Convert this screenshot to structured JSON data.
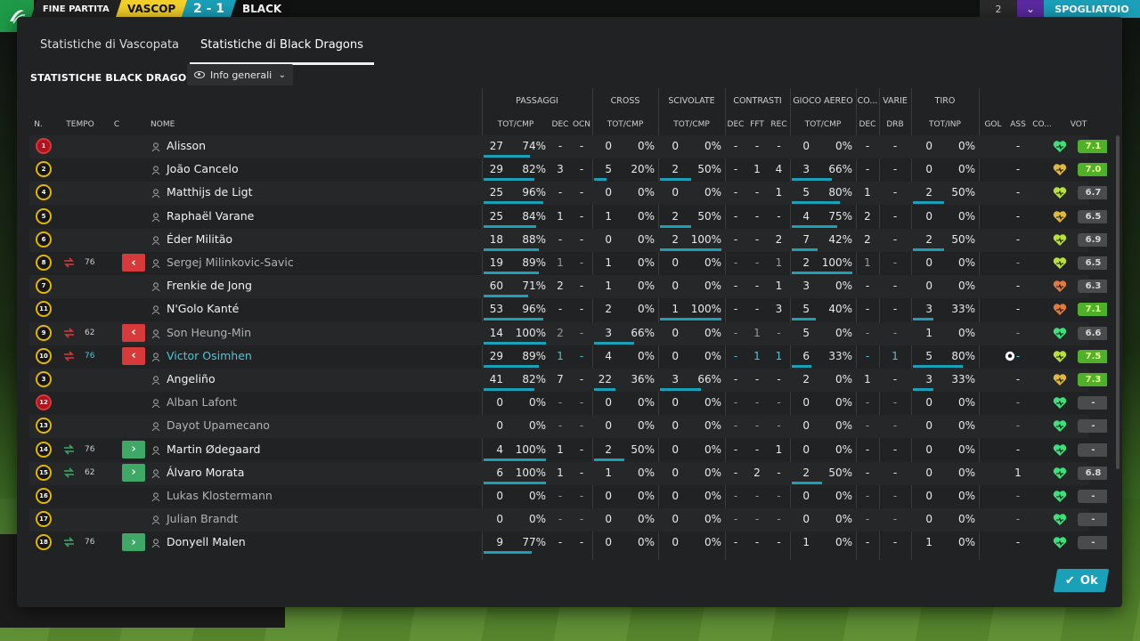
{
  "topbar": {
    "end_label": "FINE PARTITA",
    "home": "VASCOP",
    "score": "2 - 1",
    "away": "BLACK",
    "right_count": "2",
    "right_button": "SPOGLIATOIO"
  },
  "tabs": [
    {
      "label": "Statistiche di Vascopata",
      "active": false
    },
    {
      "label": "Statistiche di Black Dragons",
      "active": true
    }
  ],
  "section_title": "STATISTICHE BLACK DRAGONS",
  "dropdown": {
    "label": "Info generali",
    "icon": "eye-icon"
  },
  "groups": {
    "passaggi": "PASSAGGI",
    "cross": "CROSS",
    "scivolate": "SCIVOLATE",
    "contrasti": "CONTRASTI",
    "gioco_aereo": "GIOCO AEREO",
    "co": "CO...",
    "varie": "VARIE",
    "tiro": "TIRO"
  },
  "columns": {
    "n": "N.",
    "tempo": "TEMPO",
    "c": "C",
    "nome": "NOME",
    "pass_tot": "TOT/CMP",
    "dec": "DEC",
    "ocn": "OCN",
    "cross_tot": "TOT/CMP",
    "sciv_tot": "TOT/CMP",
    "con_dec": "DEC",
    "fft": "FFT",
    "rec": "REC",
    "aereo_tot": "TOT/CMP",
    "co_dec": "DEC",
    "drb": "DRB",
    "tiro_tot": "TOT/INP",
    "gol": "GOL",
    "ass": "ASS",
    "co2": "CO...",
    "vot": "VOT"
  },
  "players": [
    {
      "num": "1",
      "gk": true,
      "min": "",
      "sub": "",
      "name": "Alisson",
      "style": "",
      "pass": [
        "27",
        "74%"
      ],
      "pbar": 0.74,
      "pdec": "-",
      "pocn": "-",
      "cross": [
        "0",
        "0%"
      ],
      "cbar": 0,
      "sciv": [
        "0",
        "0%"
      ],
      "sbar": 0,
      "cdec": "-",
      "fft": "-",
      "rec": "-",
      "aer": [
        "0",
        "0%"
      ],
      "abar": 0,
      "codec": "-",
      "drb": "-",
      "tiro": [
        "0",
        "0%"
      ],
      "tbar": 0,
      "gol": "",
      "ass": "-",
      "heart": "#3ee07a",
      "vot": "7.1",
      "vcls": "green"
    },
    {
      "num": "2",
      "gk": false,
      "min": "",
      "sub": "",
      "name": "João Cancelo",
      "style": "",
      "pass": [
        "29",
        "82%"
      ],
      "pbar": 0.82,
      "pdec": "3",
      "pocn": "-",
      "cross": [
        "5",
        "20%"
      ],
      "cbar": 0.2,
      "sciv": [
        "2",
        "50%"
      ],
      "sbar": 0.5,
      "cdec": "-",
      "fft": "1",
      "rec": "4",
      "aer": [
        "3",
        "66%"
      ],
      "abar": 0.66,
      "codec": "-",
      "drb": "-",
      "tiro": [
        "0",
        "0%"
      ],
      "tbar": 0,
      "gol": "",
      "ass": "-",
      "heart": "#e0b840",
      "vot": "7.0",
      "vcls": "green"
    },
    {
      "num": "4",
      "gk": false,
      "min": "",
      "sub": "",
      "name": "Matthijs de Ligt",
      "style": "",
      "pass": [
        "25",
        "96%"
      ],
      "pbar": 0.96,
      "pdec": "-",
      "pocn": "-",
      "cross": [
        "0",
        "0%"
      ],
      "cbar": 0,
      "sciv": [
        "0",
        "0%"
      ],
      "sbar": 0,
      "cdec": "-",
      "fft": "-",
      "rec": "1",
      "aer": [
        "5",
        "80%"
      ],
      "abar": 0.8,
      "codec": "1",
      "drb": "-",
      "tiro": [
        "2",
        "50%"
      ],
      "tbar": 0.5,
      "gol": "",
      "ass": "-",
      "heart": "#b9e03a",
      "vot": "6.7",
      "vcls": "gray"
    },
    {
      "num": "5",
      "gk": false,
      "min": "",
      "sub": "",
      "name": "Raphaël Varane",
      "style": "",
      "pass": [
        "25",
        "84%"
      ],
      "pbar": 0.84,
      "pdec": "1",
      "pocn": "-",
      "cross": [
        "1",
        "0%"
      ],
      "cbar": 0,
      "sciv": [
        "2",
        "50%"
      ],
      "sbar": 0.5,
      "cdec": "-",
      "fft": "-",
      "rec": "-",
      "aer": [
        "4",
        "75%"
      ],
      "abar": 0.75,
      "codec": "2",
      "drb": "-",
      "tiro": [
        "0",
        "0%"
      ],
      "tbar": 0,
      "gol": "",
      "ass": "-",
      "heart": "#e0b840",
      "vot": "6.5",
      "vcls": "gray"
    },
    {
      "num": "6",
      "gk": false,
      "min": "",
      "sub": "",
      "name": "Éder Militão",
      "style": "",
      "pass": [
        "18",
        "88%"
      ],
      "pbar": 0.88,
      "pdec": "-",
      "pocn": "-",
      "cross": [
        "0",
        "0%"
      ],
      "cbar": 0,
      "sciv": [
        "2",
        "100%"
      ],
      "sbar": 1,
      "cdec": "-",
      "fft": "-",
      "rec": "2",
      "aer": [
        "7",
        "42%"
      ],
      "abar": 0.42,
      "codec": "2",
      "drb": "-",
      "tiro": [
        "2",
        "50%"
      ],
      "tbar": 0.5,
      "gol": "",
      "ass": "-",
      "heart": "#b9e03a",
      "vot": "6.9",
      "vcls": "gray"
    },
    {
      "num": "8",
      "gk": false,
      "min": "76",
      "sub": "out",
      "name": "Sergej Milinkovic-Savic",
      "style": "dim",
      "pass": [
        "19",
        "89%"
      ],
      "pbar": 0.89,
      "pdec": "1",
      "pocn": "-",
      "cross": [
        "1",
        "0%"
      ],
      "cbar": 0,
      "sciv": [
        "0",
        "0%"
      ],
      "sbar": 0,
      "cdec": "-",
      "fft": "-",
      "rec": "1",
      "aer": [
        "2",
        "100%"
      ],
      "abar": 1,
      "codec": "1",
      "drb": "-",
      "tiro": [
        "0",
        "0%"
      ],
      "tbar": 0,
      "gol": "",
      "ass": "-",
      "heart": "#b9e03a",
      "vot": "6.5",
      "vcls": "gray"
    },
    {
      "num": "7",
      "gk": false,
      "min": "",
      "sub": "",
      "name": "Frenkie de Jong",
      "style": "",
      "pass": [
        "60",
        "71%"
      ],
      "pbar": 0.71,
      "pdec": "2",
      "pocn": "-",
      "cross": [
        "1",
        "0%"
      ],
      "cbar": 0,
      "sciv": [
        "0",
        "0%"
      ],
      "sbar": 0,
      "cdec": "-",
      "fft": "-",
      "rec": "1",
      "aer": [
        "3",
        "0%"
      ],
      "abar": 0,
      "codec": "-",
      "drb": "-",
      "tiro": [
        "0",
        "0%"
      ],
      "tbar": 0,
      "gol": "",
      "ass": "-",
      "heart": "#e07a40",
      "vot": "6.3",
      "vcls": "gray"
    },
    {
      "num": "11",
      "gk": false,
      "min": "",
      "sub": "",
      "name": "N'Golo Kanté",
      "style": "",
      "pass": [
        "53",
        "96%"
      ],
      "pbar": 0.96,
      "pdec": "-",
      "pocn": "-",
      "cross": [
        "2",
        "0%"
      ],
      "cbar": 0,
      "sciv": [
        "1",
        "100%"
      ],
      "sbar": 1,
      "cdec": "-",
      "fft": "-",
      "rec": "3",
      "aer": [
        "5",
        "40%"
      ],
      "abar": 0.4,
      "codec": "-",
      "drb": "-",
      "tiro": [
        "3",
        "33%"
      ],
      "tbar": 0.33,
      "gol": "",
      "ass": "-",
      "heart": "#e07a40",
      "vot": "7.1",
      "vcls": "green"
    },
    {
      "num": "9",
      "gk": false,
      "min": "62",
      "sub": "out",
      "name": "Son Heung-Min",
      "style": "dim",
      "pass": [
        "14",
        "100%"
      ],
      "pbar": 1,
      "pdec": "2",
      "pocn": "-",
      "cross": [
        "3",
        "66%"
      ],
      "cbar": 0.66,
      "sciv": [
        "0",
        "0%"
      ],
      "sbar": 0,
      "cdec": "-",
      "fft": "1",
      "rec": "-",
      "aer": [
        "5",
        "0%"
      ],
      "abar": 0,
      "codec": "-",
      "drb": "-",
      "tiro": [
        "1",
        "0%"
      ],
      "tbar": 0,
      "gol": "",
      "ass": "-",
      "heart": "#3ee07a",
      "vot": "6.6",
      "vcls": "gray"
    },
    {
      "num": "10",
      "gk": false,
      "min": "76",
      "sub": "out",
      "name": "Victor Osimhen",
      "style": "hl",
      "pass": [
        "29",
        "89%"
      ],
      "pbar": 0.89,
      "pdec": "1",
      "pocn": "-",
      "cross": [
        "4",
        "0%"
      ],
      "cbar": 0,
      "sciv": [
        "0",
        "0%"
      ],
      "sbar": 0,
      "cdec": "-",
      "fft": "1",
      "rec": "1",
      "aer": [
        "6",
        "33%"
      ],
      "abar": 0.33,
      "codec": "-",
      "drb": "1",
      "tiro": [
        "5",
        "80%"
      ],
      "tbar": 0.8,
      "gol": "ball",
      "ass": "-",
      "heart": "#b9e03a",
      "vot": "7.5",
      "vcls": "green"
    },
    {
      "num": "3",
      "gk": false,
      "min": "",
      "sub": "",
      "name": "Angeliño",
      "style": "",
      "pass": [
        "41",
        "82%"
      ],
      "pbar": 0.82,
      "pdec": "7",
      "pocn": "-",
      "cross": [
        "22",
        "36%"
      ],
      "cbar": 0.36,
      "sciv": [
        "3",
        "66%"
      ],
      "sbar": 0.66,
      "cdec": "-",
      "fft": "-",
      "rec": "-",
      "aer": [
        "2",
        "0%"
      ],
      "abar": 0,
      "codec": "1",
      "drb": "-",
      "tiro": [
        "3",
        "33%"
      ],
      "tbar": 0.33,
      "gol": "",
      "ass": "-",
      "heart": "#e0b840",
      "vot": "7.3",
      "vcls": "green"
    },
    {
      "num": "12",
      "gk": true,
      "min": "",
      "sub": "",
      "name": "Alban Lafont",
      "style": "dim",
      "pass": [
        "0",
        "0%"
      ],
      "pbar": 0,
      "pdec": "-",
      "pocn": "-",
      "cross": [
        "0",
        "0%"
      ],
      "cbar": 0,
      "sciv": [
        "0",
        "0%"
      ],
      "sbar": 0,
      "cdec": "-",
      "fft": "-",
      "rec": "-",
      "aer": [
        "0",
        "0%"
      ],
      "abar": 0,
      "codec": "-",
      "drb": "-",
      "tiro": [
        "0",
        "0%"
      ],
      "tbar": 0,
      "gol": "",
      "ass": "-",
      "heart": "#3ee07a",
      "vot": "-",
      "vcls": "gray"
    },
    {
      "num": "13",
      "gk": false,
      "min": "",
      "sub": "",
      "name": "Dayot Upamecano",
      "style": "dim",
      "pass": [
        "0",
        "0%"
      ],
      "pbar": 0,
      "pdec": "-",
      "pocn": "-",
      "cross": [
        "0",
        "0%"
      ],
      "cbar": 0,
      "sciv": [
        "0",
        "0%"
      ],
      "sbar": 0,
      "cdec": "-",
      "fft": "-",
      "rec": "-",
      "aer": [
        "0",
        "0%"
      ],
      "abar": 0,
      "codec": "-",
      "drb": "-",
      "tiro": [
        "0",
        "0%"
      ],
      "tbar": 0,
      "gol": "",
      "ass": "-",
      "heart": "#3ee07a",
      "vot": "-",
      "vcls": "gray"
    },
    {
      "num": "14",
      "gk": false,
      "min": "76",
      "sub": "in",
      "name": "Martin Ødegaard",
      "style": "",
      "pass": [
        "4",
        "100%"
      ],
      "pbar": 1,
      "pdec": "1",
      "pocn": "-",
      "cross": [
        "2",
        "50%"
      ],
      "cbar": 0.5,
      "sciv": [
        "0",
        "0%"
      ],
      "sbar": 0,
      "cdec": "-",
      "fft": "-",
      "rec": "1",
      "aer": [
        "0",
        "0%"
      ],
      "abar": 0,
      "codec": "-",
      "drb": "-",
      "tiro": [
        "0",
        "0%"
      ],
      "tbar": 0,
      "gol": "",
      "ass": "-",
      "heart": "#3ee07a",
      "vot": "-",
      "vcls": "gray"
    },
    {
      "num": "15",
      "gk": false,
      "min": "62",
      "sub": "in",
      "name": "Álvaro Morata",
      "style": "",
      "pass": [
        "6",
        "100%"
      ],
      "pbar": 1,
      "pdec": "1",
      "pocn": "-",
      "cross": [
        "1",
        "0%"
      ],
      "cbar": 0,
      "sciv": [
        "0",
        "0%"
      ],
      "sbar": 0,
      "cdec": "-",
      "fft": "2",
      "rec": "-",
      "aer": [
        "2",
        "50%"
      ],
      "abar": 0.5,
      "codec": "-",
      "drb": "-",
      "tiro": [
        "0",
        "0%"
      ],
      "tbar": 0,
      "gol": "",
      "ass": "1",
      "heart": "#3ee07a",
      "vot": "6.8",
      "vcls": "gray"
    },
    {
      "num": "16",
      "gk": false,
      "min": "",
      "sub": "",
      "name": "Lukas Klostermann",
      "style": "dim",
      "pass": [
        "0",
        "0%"
      ],
      "pbar": 0,
      "pdec": "-",
      "pocn": "-",
      "cross": [
        "0",
        "0%"
      ],
      "cbar": 0,
      "sciv": [
        "0",
        "0%"
      ],
      "sbar": 0,
      "cdec": "-",
      "fft": "-",
      "rec": "-",
      "aer": [
        "0",
        "0%"
      ],
      "abar": 0,
      "codec": "-",
      "drb": "-",
      "tiro": [
        "0",
        "0%"
      ],
      "tbar": 0,
      "gol": "",
      "ass": "-",
      "heart": "#3ee07a",
      "vot": "-",
      "vcls": "gray"
    },
    {
      "num": "17",
      "gk": false,
      "min": "",
      "sub": "",
      "name": "Julian Brandt",
      "style": "dim",
      "pass": [
        "0",
        "0%"
      ],
      "pbar": 0,
      "pdec": "-",
      "pocn": "-",
      "cross": [
        "0",
        "0%"
      ],
      "cbar": 0,
      "sciv": [
        "0",
        "0%"
      ],
      "sbar": 0,
      "cdec": "-",
      "fft": "-",
      "rec": "-",
      "aer": [
        "0",
        "0%"
      ],
      "abar": 0,
      "codec": "-",
      "drb": "-",
      "tiro": [
        "0",
        "0%"
      ],
      "tbar": 0,
      "gol": "",
      "ass": "-",
      "heart": "#3ee07a",
      "vot": "-",
      "vcls": "gray"
    },
    {
      "num": "18",
      "gk": false,
      "min": "76",
      "sub": "in",
      "name": "Donyell Malen",
      "style": "",
      "pass": [
        "9",
        "77%"
      ],
      "pbar": 0.77,
      "pdec": "-",
      "pocn": "-",
      "cross": [
        "0",
        "0%"
      ],
      "cbar": 0,
      "sciv": [
        "0",
        "0%"
      ],
      "sbar": 0,
      "cdec": "-",
      "fft": "-",
      "rec": "-",
      "aer": [
        "1",
        "0%"
      ],
      "abar": 0,
      "codec": "-",
      "drb": "-",
      "tiro": [
        "1",
        "0%"
      ],
      "tbar": 0,
      "gol": "",
      "ass": "-",
      "heart": "#3ee07a",
      "vot": "-",
      "vcls": "gray"
    }
  ],
  "ok_label": "Ok",
  "colors": {
    "accent": "#1aa0b8",
    "out": "#d63a3a",
    "in": "#3fa866",
    "rating_green": "#4fb12a"
  }
}
